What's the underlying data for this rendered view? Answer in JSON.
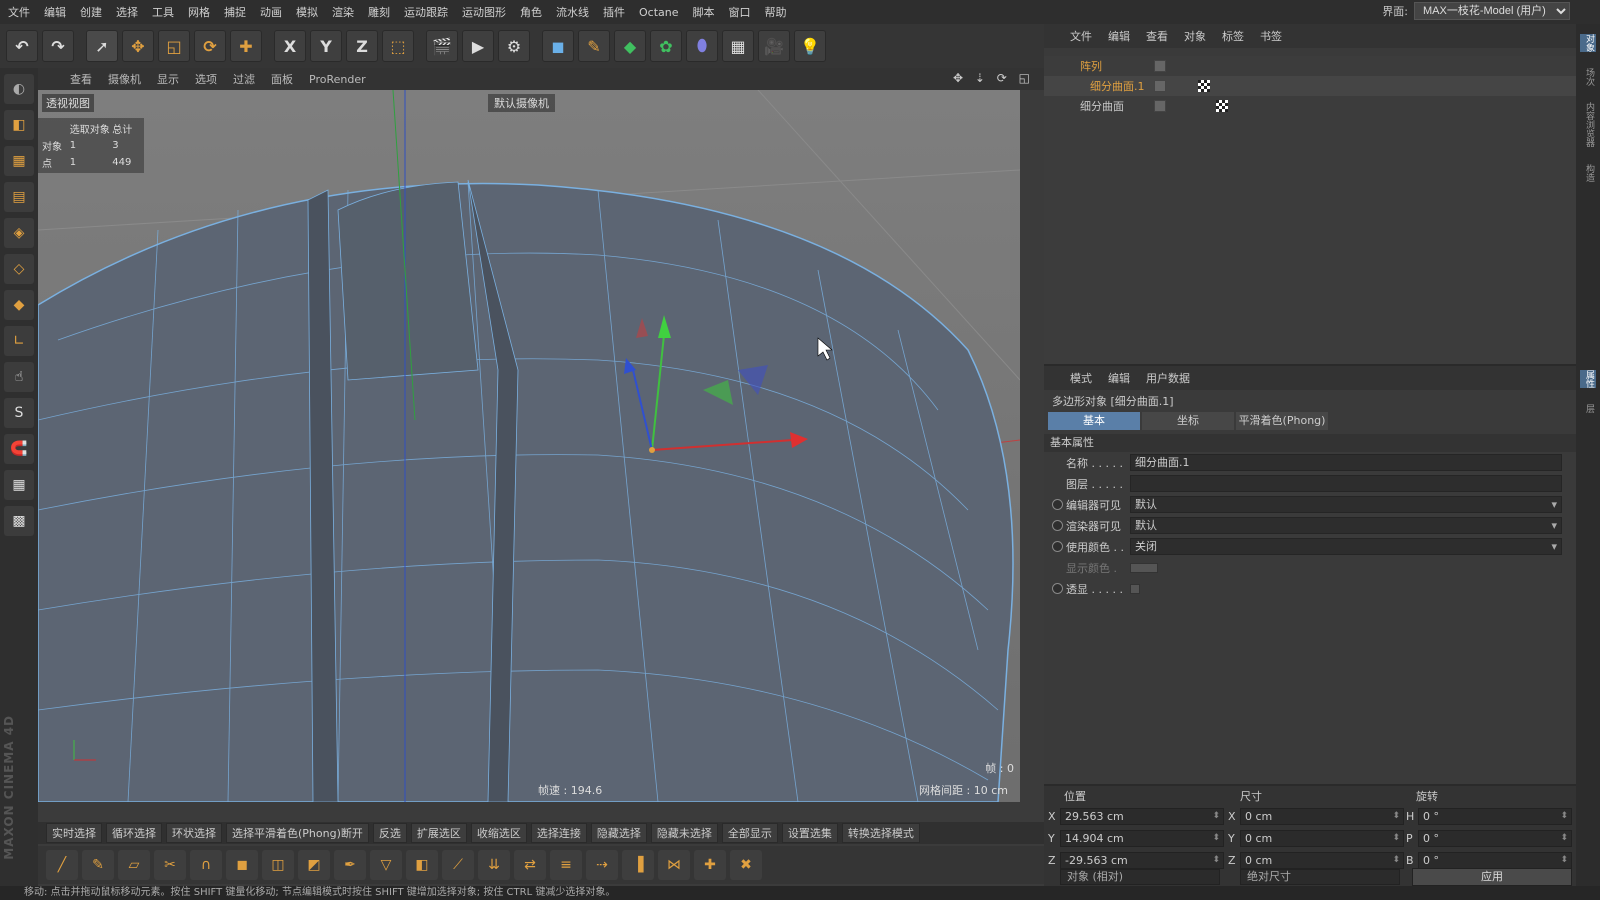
{
  "menubar": {
    "items": [
      "文件",
      "编辑",
      "创建",
      "选择",
      "工具",
      "网格",
      "捕捉",
      "动画",
      "模拟",
      "渲染",
      "雕刻",
      "运动跟踪",
      "运动图形",
      "角色",
      "流水线",
      "插件",
      "Octane",
      "脚本",
      "窗口",
      "帮助"
    ],
    "interface_label": "界面:",
    "interface_value": "MAX一枝花-Model (用户)"
  },
  "toolbar": {
    "icons": [
      "undo-icon",
      "redo-icon",
      "select-icon",
      "move-icon",
      "scale-icon",
      "rotate-icon",
      "transform-icon",
      "x-axis-icon",
      "y-axis-icon",
      "z-axis-icon",
      "coord-system-icon",
      "render-view-icon",
      "render-picture-icon",
      "render-settings-icon",
      "cube-icon",
      "pen-icon",
      "subdivision-icon",
      "array-icon",
      "deformer-icon",
      "floor-icon",
      "camera-icon",
      "light-icon"
    ],
    "glyphs": [
      "↶",
      "↷",
      "➚",
      "✥",
      "◱",
      "⟳",
      "✚",
      "X",
      "Y",
      "Z",
      "⬚",
      "🎬",
      "▶",
      "⚙",
      "◼",
      "✎",
      "◆",
      "✿",
      "⬮",
      "▦",
      "🎥",
      "💡"
    ]
  },
  "leftbar": {
    "icons": [
      "model-mode-icon",
      "object-mode-icon",
      "texture-mode-icon",
      "workplane-icon",
      "points-mode-icon",
      "edges-mode-icon",
      "polygons-mode-icon",
      "axis-icon",
      "tweak-icon",
      "snap-icon",
      "magnet-icon",
      "grid-lock-icon",
      "workplane-lock-icon"
    ],
    "glyphs": [
      "◐",
      "◧",
      "▦",
      "▤",
      "◈",
      "◇",
      "◆",
      "∟",
      "☝",
      "S",
      "🧲",
      "▦",
      "▩"
    ],
    "brand": "MAXON CINEMA 4D"
  },
  "viewport": {
    "menu": [
      "查看",
      "摄像机",
      "显示",
      "选项",
      "过滤",
      "面板",
      "ProRender"
    ],
    "nav_icons": "✥ ⇣ ⟳ ◱",
    "label": "透视视图",
    "camera": "默认摄像机",
    "stats": {
      "header": [
        "",
        "选取对象",
        "总计"
      ],
      "rows": [
        [
          "对象",
          "1",
          "3"
        ],
        [
          "点",
          "1",
          "449"
        ]
      ]
    },
    "speed": "帧速 : 194.6",
    "grid": "网格间距 : 10 cm",
    "frame": "帧 : 0"
  },
  "bottombar1": [
    "实时选择",
    "循环选择",
    "环状选择",
    "选择平滑着色(Phong)断开",
    "反选",
    "扩展选区",
    "收缩选区",
    "选择连接",
    "隐藏选择",
    "隐藏未选择",
    "全部显示",
    "设置选集",
    "转换选择模式"
  ],
  "bottombar2": {
    "icons": [
      "line-cut-icon",
      "brush-icon",
      "plane-cut-icon",
      "knife-icon",
      "magnet-icon",
      "extrude-icon",
      "inner-extrude-icon",
      "bevel-icon",
      "pen-icon",
      "polygon-pen-icon",
      "bridge-icon",
      "weld-icon",
      "stitch-icon",
      "slide-icon",
      "iron-icon",
      "edge-cut-icon",
      "mirror-icon",
      "connect-icon",
      "optimize-icon",
      "melt-icon"
    ],
    "glyphs": [
      "╱",
      "✎",
      "▱",
      "✂",
      "∩",
      "◼",
      "◫",
      "◩",
      "✒",
      "▽",
      "◧",
      "⟋",
      "⇊",
      "⇄",
      "≡",
      "⇢",
      "▐",
      "⋈",
      "✚",
      "✖"
    ]
  },
  "status": "移动: 点击并拖动鼠标移动元素。按住 SHIFT 键量化移动; 节点编辑模式时按住 SHIFT 键增加选择对象; 按住 CTRL 键减少选择对象。",
  "objects": {
    "menu": [
      "文件",
      "编辑",
      "查看",
      "对象",
      "标签",
      "书签"
    ],
    "items": [
      {
        "name": "阵列",
        "color": "#e0a040"
      },
      {
        "name": "细分曲面.1",
        "color": "#e0a040"
      },
      {
        "name": "细分曲面",
        "color": "#c8c8c8"
      }
    ]
  },
  "attributes": {
    "menu": [
      "模式",
      "编辑",
      "用户数据"
    ],
    "title": "多边形对象 [细分曲面.1]",
    "tabs": [
      "基本",
      "坐标",
      "平滑着色(Phong)"
    ],
    "section": "基本属性",
    "props": [
      {
        "label": "名称 . . . . .",
        "value": "细分曲面.1"
      },
      {
        "label": "图层 . . . . .",
        "value": ""
      },
      {
        "label": "编辑器可见",
        "value": "默认"
      },
      {
        "label": "渲染器可见",
        "value": "默认"
      },
      {
        "label": "使用颜色 . .",
        "value": "关闭"
      },
      {
        "label": "显示颜色 .",
        "value": ""
      },
      {
        "label": "透显 . . . . .",
        "value": ""
      }
    ]
  },
  "coords": {
    "headers": [
      "位置",
      "尺寸",
      "旋转"
    ],
    "rows": [
      {
        "a1": "X",
        "v1": "29.563 cm",
        "a2": "X",
        "v2": "0 cm",
        "a3": "H",
        "v3": "0 °"
      },
      {
        "a1": "Y",
        "v1": "14.904 cm",
        "a2": "Y",
        "v2": "0 cm",
        "a3": "P",
        "v3": "0 °"
      },
      {
        "a1": "Z",
        "v1": "-29.563 cm",
        "a2": "Z",
        "v2": "0 cm",
        "a3": "B",
        "v3": "0 °"
      }
    ],
    "mode": "对象 (相对)",
    "size_mode": "绝对尺寸",
    "apply": "应用"
  },
  "sidestrip": [
    "对象",
    "场次",
    "内容浏览器",
    "构造",
    "属性",
    "层"
  ]
}
